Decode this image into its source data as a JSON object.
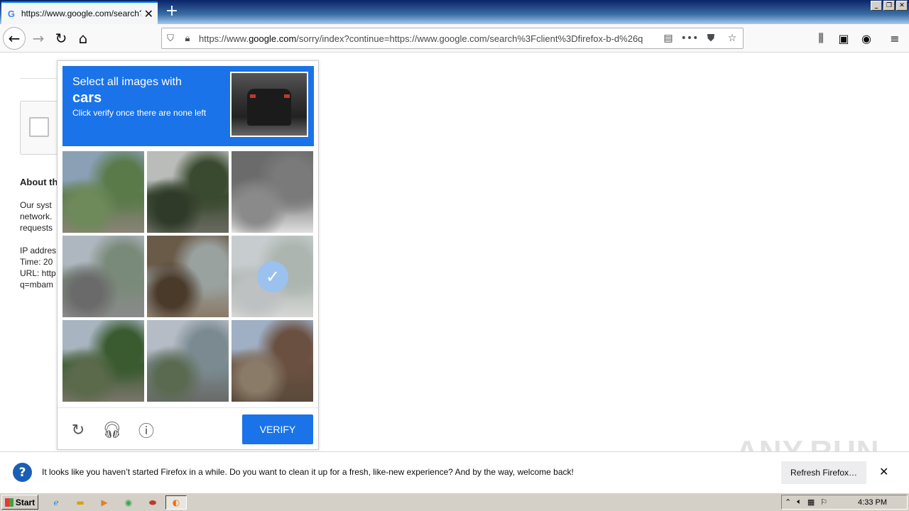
{
  "browser": {
    "tab_title": "https://www.google.com/search?c",
    "tab_favicon": "G",
    "url_prefix": "https://www.",
    "url_domain": "google.com",
    "url_rest": "/sorry/index?continue=https://www.google.com/search%3Fclient%3Dfirefox-b-d%26q"
  },
  "background_page": {
    "heading": "About th",
    "lines": [
      "Our syst",
      "network.",
      "requests",
      "",
      "IP addres",
      "Time: 20",
      "URL: http",
      "q=mbam"
    ]
  },
  "captcha": {
    "prompt_line1": "Select all images with",
    "prompt_object": "cars",
    "prompt_line3": "Click verify once there are none left",
    "verify_label": "VERIFY",
    "tiles": [
      {
        "name": "tile-mountain-road",
        "selected": false,
        "colors": [
          "#8aa0b5",
          "#5a7a4a",
          "#6e8a5a",
          "#8a8478"
        ]
      },
      {
        "name": "tile-palm-tree",
        "selected": false,
        "colors": [
          "#b9bcb8",
          "#3a4a30",
          "#2f3a28",
          "#6a6a60"
        ]
      },
      {
        "name": "tile-crosswalk",
        "selected": false,
        "colors": [
          "#6b6b6b",
          "#7a7a7a",
          "#8a8a8a",
          "#e0e0e0"
        ]
      },
      {
        "name": "tile-highway",
        "selected": false,
        "colors": [
          "#aeb6bf",
          "#7a8a7a",
          "#6a6a6a",
          "#8a8a8a"
        ]
      },
      {
        "name": "tile-glass-door",
        "selected": false,
        "colors": [
          "#6a5a48",
          "#9aa2a0",
          "#4a3a2a",
          "#8a7a68"
        ]
      },
      {
        "name": "tile-parked-cars",
        "selected": true,
        "colors": [
          "#9aa5a8",
          "#6a7a70",
          "#8a8f90",
          "#b5b8b5"
        ]
      },
      {
        "name": "tile-trees-road",
        "selected": false,
        "colors": [
          "#a8b5c0",
          "#3a5a30",
          "#5a6a4a",
          "#7a756a"
        ]
      },
      {
        "name": "tile-traffic-light",
        "selected": false,
        "colors": [
          "#b5bcc5",
          "#7a8a90",
          "#5a6a50",
          "#6a6a68"
        ]
      },
      {
        "name": "tile-house-roof",
        "selected": false,
        "colors": [
          "#9fb0c5",
          "#6a5040",
          "#8a7a68",
          "#5a4a3a"
        ]
      }
    ]
  },
  "notification": {
    "message": "It looks like you haven’t started Firefox in a while. Do you want to clean it up for a fresh, like-new experience? And by the way, welcome back!",
    "button": "Refresh Firefox…"
  },
  "watermark": "ANY.RUN",
  "taskbar": {
    "start_label": "Start",
    "clock": "4:33 PM"
  }
}
